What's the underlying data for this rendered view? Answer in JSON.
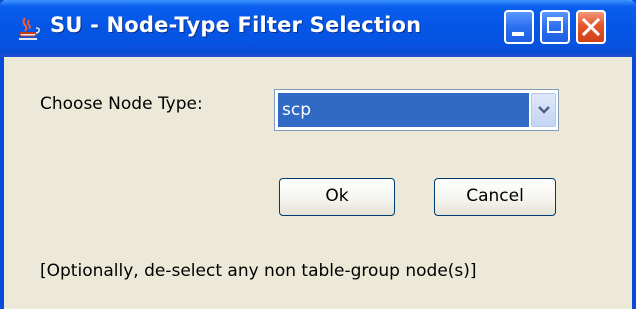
{
  "window": {
    "title": "SU - Node-Type Filter Selection",
    "icon": "java-cup-icon",
    "controls": [
      "minimize-icon",
      "maximize-icon",
      "close-icon"
    ]
  },
  "form": {
    "choose_label": "Choose Node Type:",
    "node_type_value": "scp"
  },
  "buttons": {
    "ok_label": "Ok",
    "cancel_label": "Cancel"
  },
  "note": "[Optionally, de-select any non table-group node(s)]",
  "colors": {
    "titlebar": "#0556e6",
    "dialog_bg": "#ece9d8",
    "selection": "#316ac5",
    "close_button": "#e3552a"
  }
}
